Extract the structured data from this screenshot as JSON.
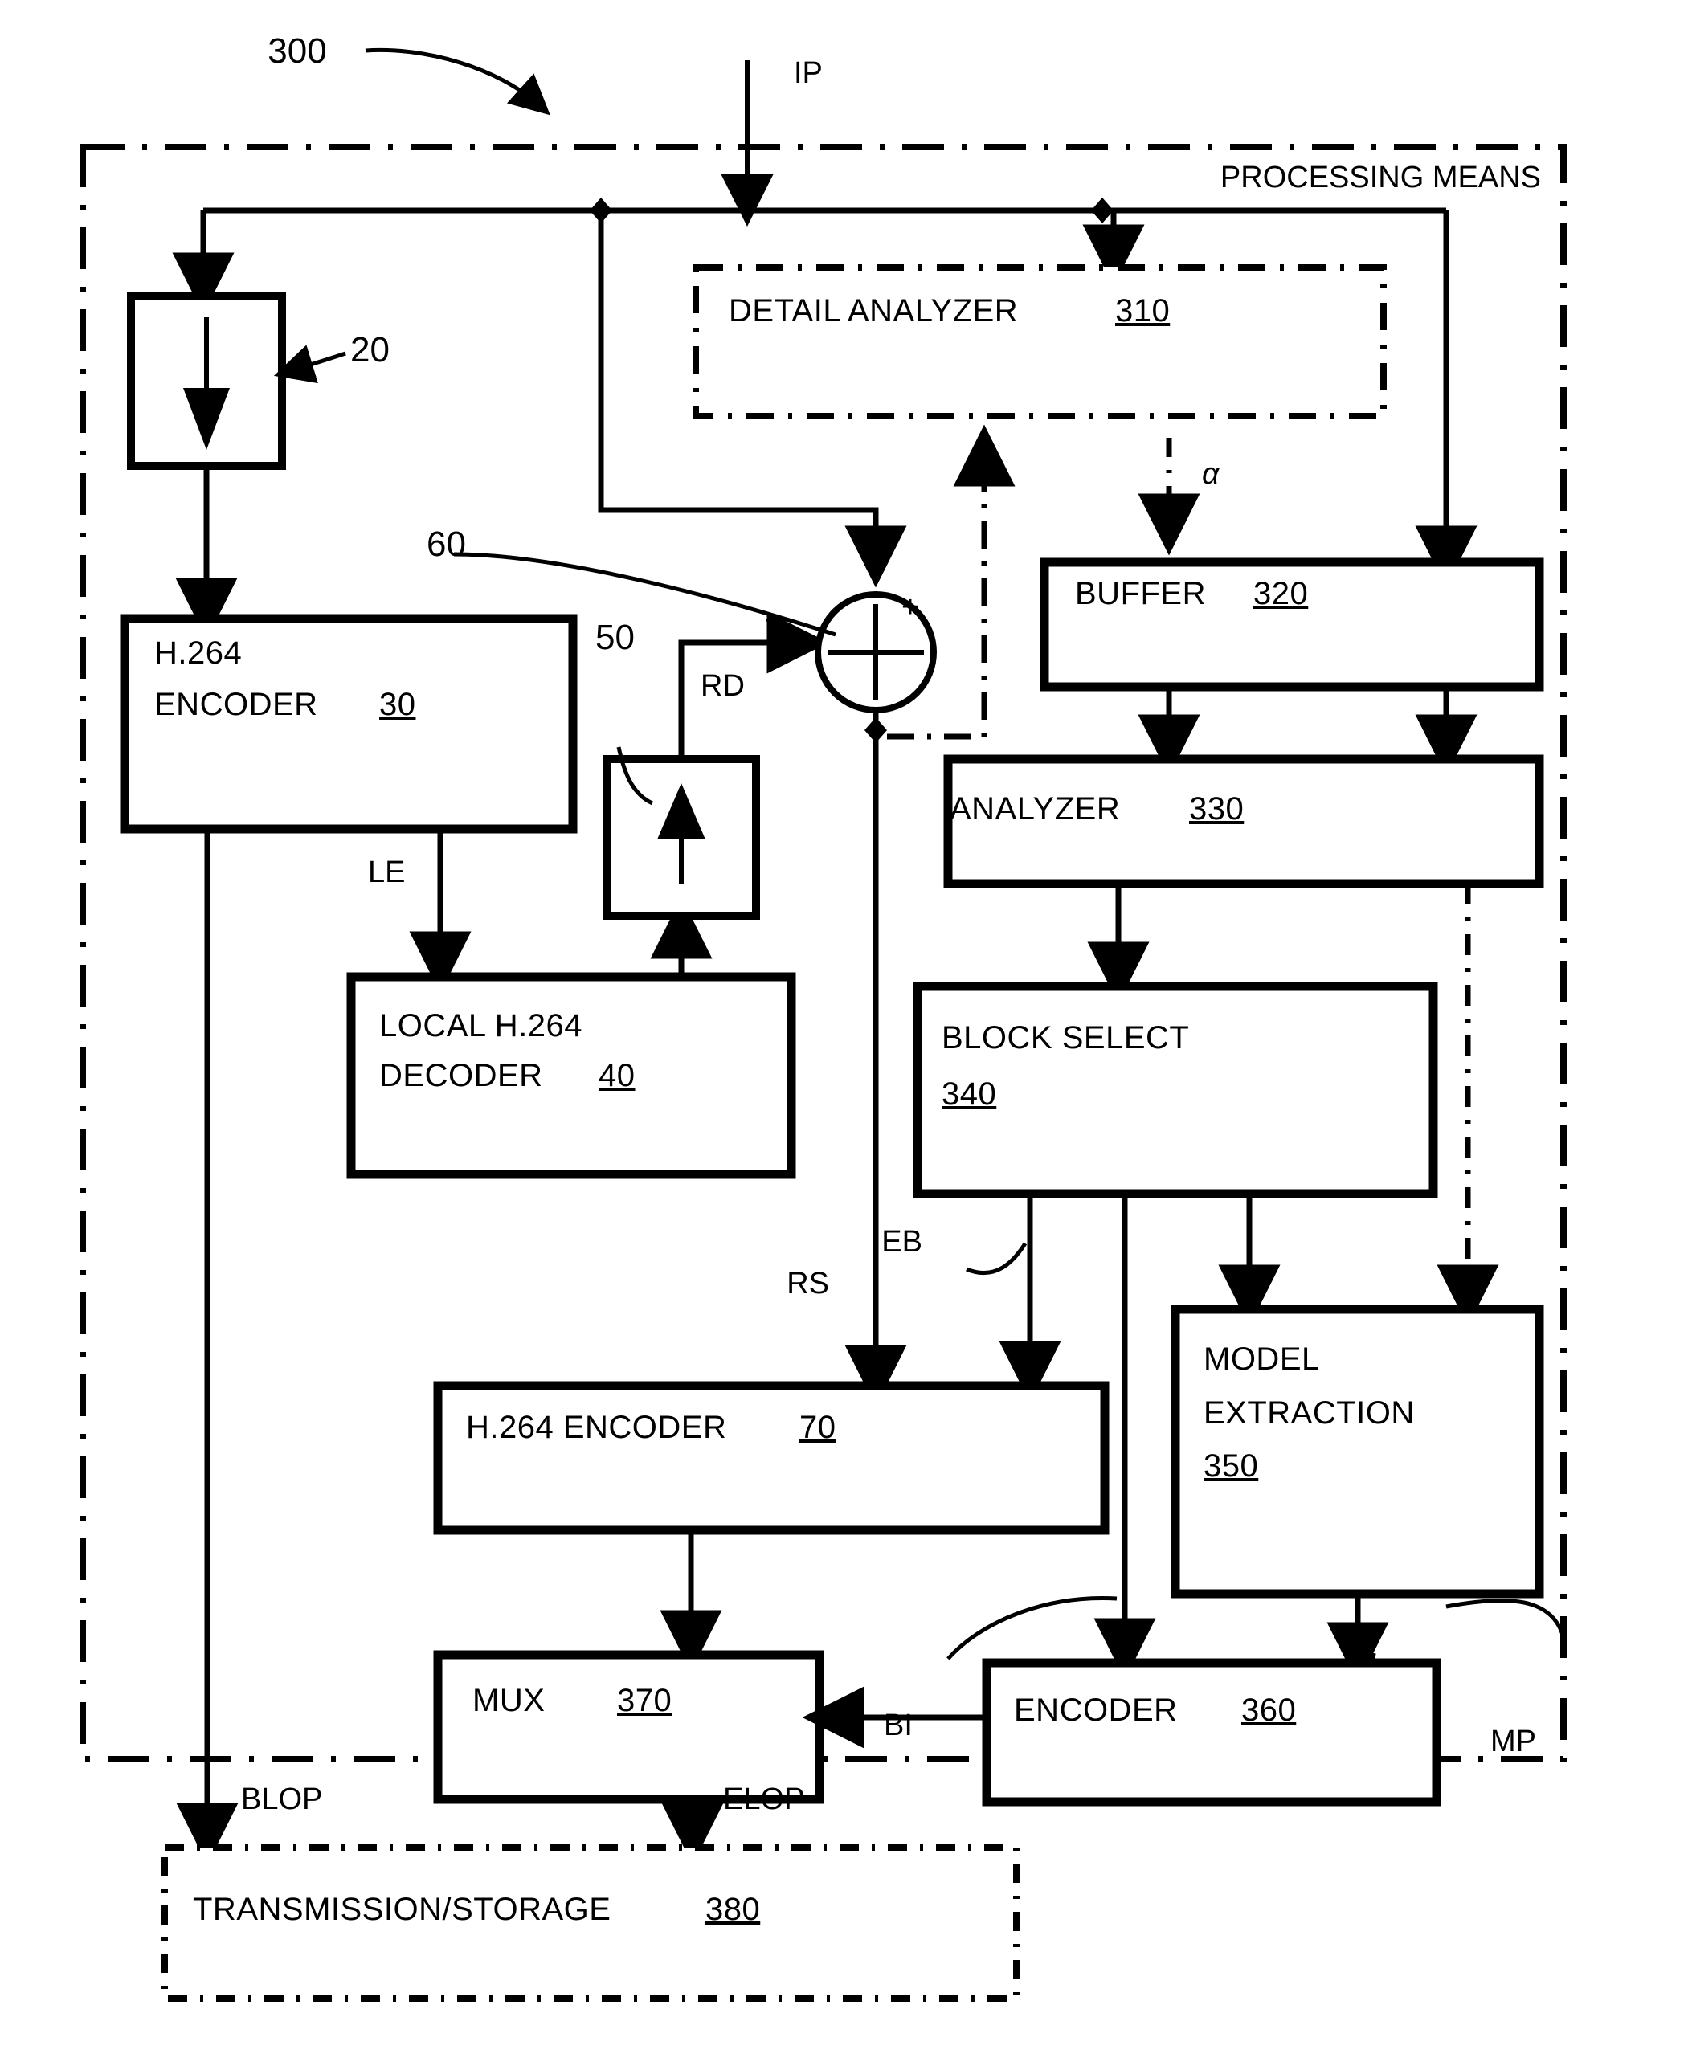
{
  "figure": {
    "figure_number": "300",
    "enclosure_label": "PROCESSING MEANS",
    "input_signal": "IP"
  },
  "blocks": [
    {
      "id": "b20",
      "label": "",
      "ref": "20",
      "kind": "down-arrow-box"
    },
    {
      "id": "b310",
      "label": "DETAIL ANALYZER",
      "ref": "310",
      "kind": "dashed-box"
    },
    {
      "id": "b30",
      "label_line1": "H.264",
      "label_line2": "ENCODER",
      "ref": "30",
      "kind": "solid-box"
    },
    {
      "id": "b320",
      "label": "BUFFER",
      "ref": "320",
      "kind": "solid-box"
    },
    {
      "id": "b50",
      "label": "",
      "ref": "50",
      "kind": "up-arrow-box"
    },
    {
      "id": "b330",
      "label": "ANALYZER",
      "ref": "330",
      "kind": "solid-box"
    },
    {
      "id": "b40",
      "label_line1": "LOCAL H.264",
      "label_line2": "DECODER",
      "ref": "40",
      "kind": "solid-box"
    },
    {
      "id": "b340",
      "label": "BLOCK SELECT",
      "ref": "340",
      "kind": "solid-box"
    },
    {
      "id": "b350",
      "label_line1": "MODEL",
      "label_line2": "EXTRACTION",
      "ref": "350",
      "kind": "solid-box"
    },
    {
      "id": "b70",
      "label": "H.264 ENCODER",
      "ref": "70",
      "kind": "solid-box"
    },
    {
      "id": "b370",
      "label": "MUX",
      "ref": "370",
      "kind": "solid-box"
    },
    {
      "id": "b360",
      "label": "ENCODER",
      "ref": "360",
      "kind": "solid-box"
    },
    {
      "id": "b380",
      "label": "TRANSMISSION/STORAGE",
      "ref": "380",
      "kind": "dashed-box"
    }
  ],
  "labels": {
    "b20_ref": "20",
    "b50_ref": "50",
    "b60_ref": "60",
    "b310_name": "DETAIL ANALYZER",
    "b310_ref": "310",
    "b30_l1": "H.264",
    "b30_l2": "ENCODER",
    "b30_ref": "30",
    "b320_name": "BUFFER",
    "b320_ref": "320",
    "b330_name": "ANALYZER",
    "b330_ref": "330",
    "b40_l1": "LOCAL H.264",
    "b40_l2": "DECODER",
    "b40_ref": "40",
    "b340_name": "BLOCK SELECT",
    "b340_ref": "340",
    "b350_l1": "MODEL",
    "b350_l2": "EXTRACTION",
    "b350_ref": "350",
    "b70_name": "H.264 ENCODER",
    "b70_ref": "70",
    "b370_name": "MUX",
    "b370_ref": "370",
    "b360_name": "ENCODER",
    "b360_ref": "360",
    "b380_name": "TRANSMISSION/STORAGE",
    "b380_ref": "380"
  },
  "signals": {
    "ip": "IP",
    "alpha": "α",
    "le": "LE",
    "rd": "RD",
    "rs": "RS",
    "eb": "EB",
    "bi": "BI",
    "mp": "MP",
    "blop": "BLOP",
    "elop": "ELOP",
    "plus": "+",
    "minus": "−"
  },
  "colors": {
    "stroke": "#000000",
    "background": "#ffffff"
  }
}
